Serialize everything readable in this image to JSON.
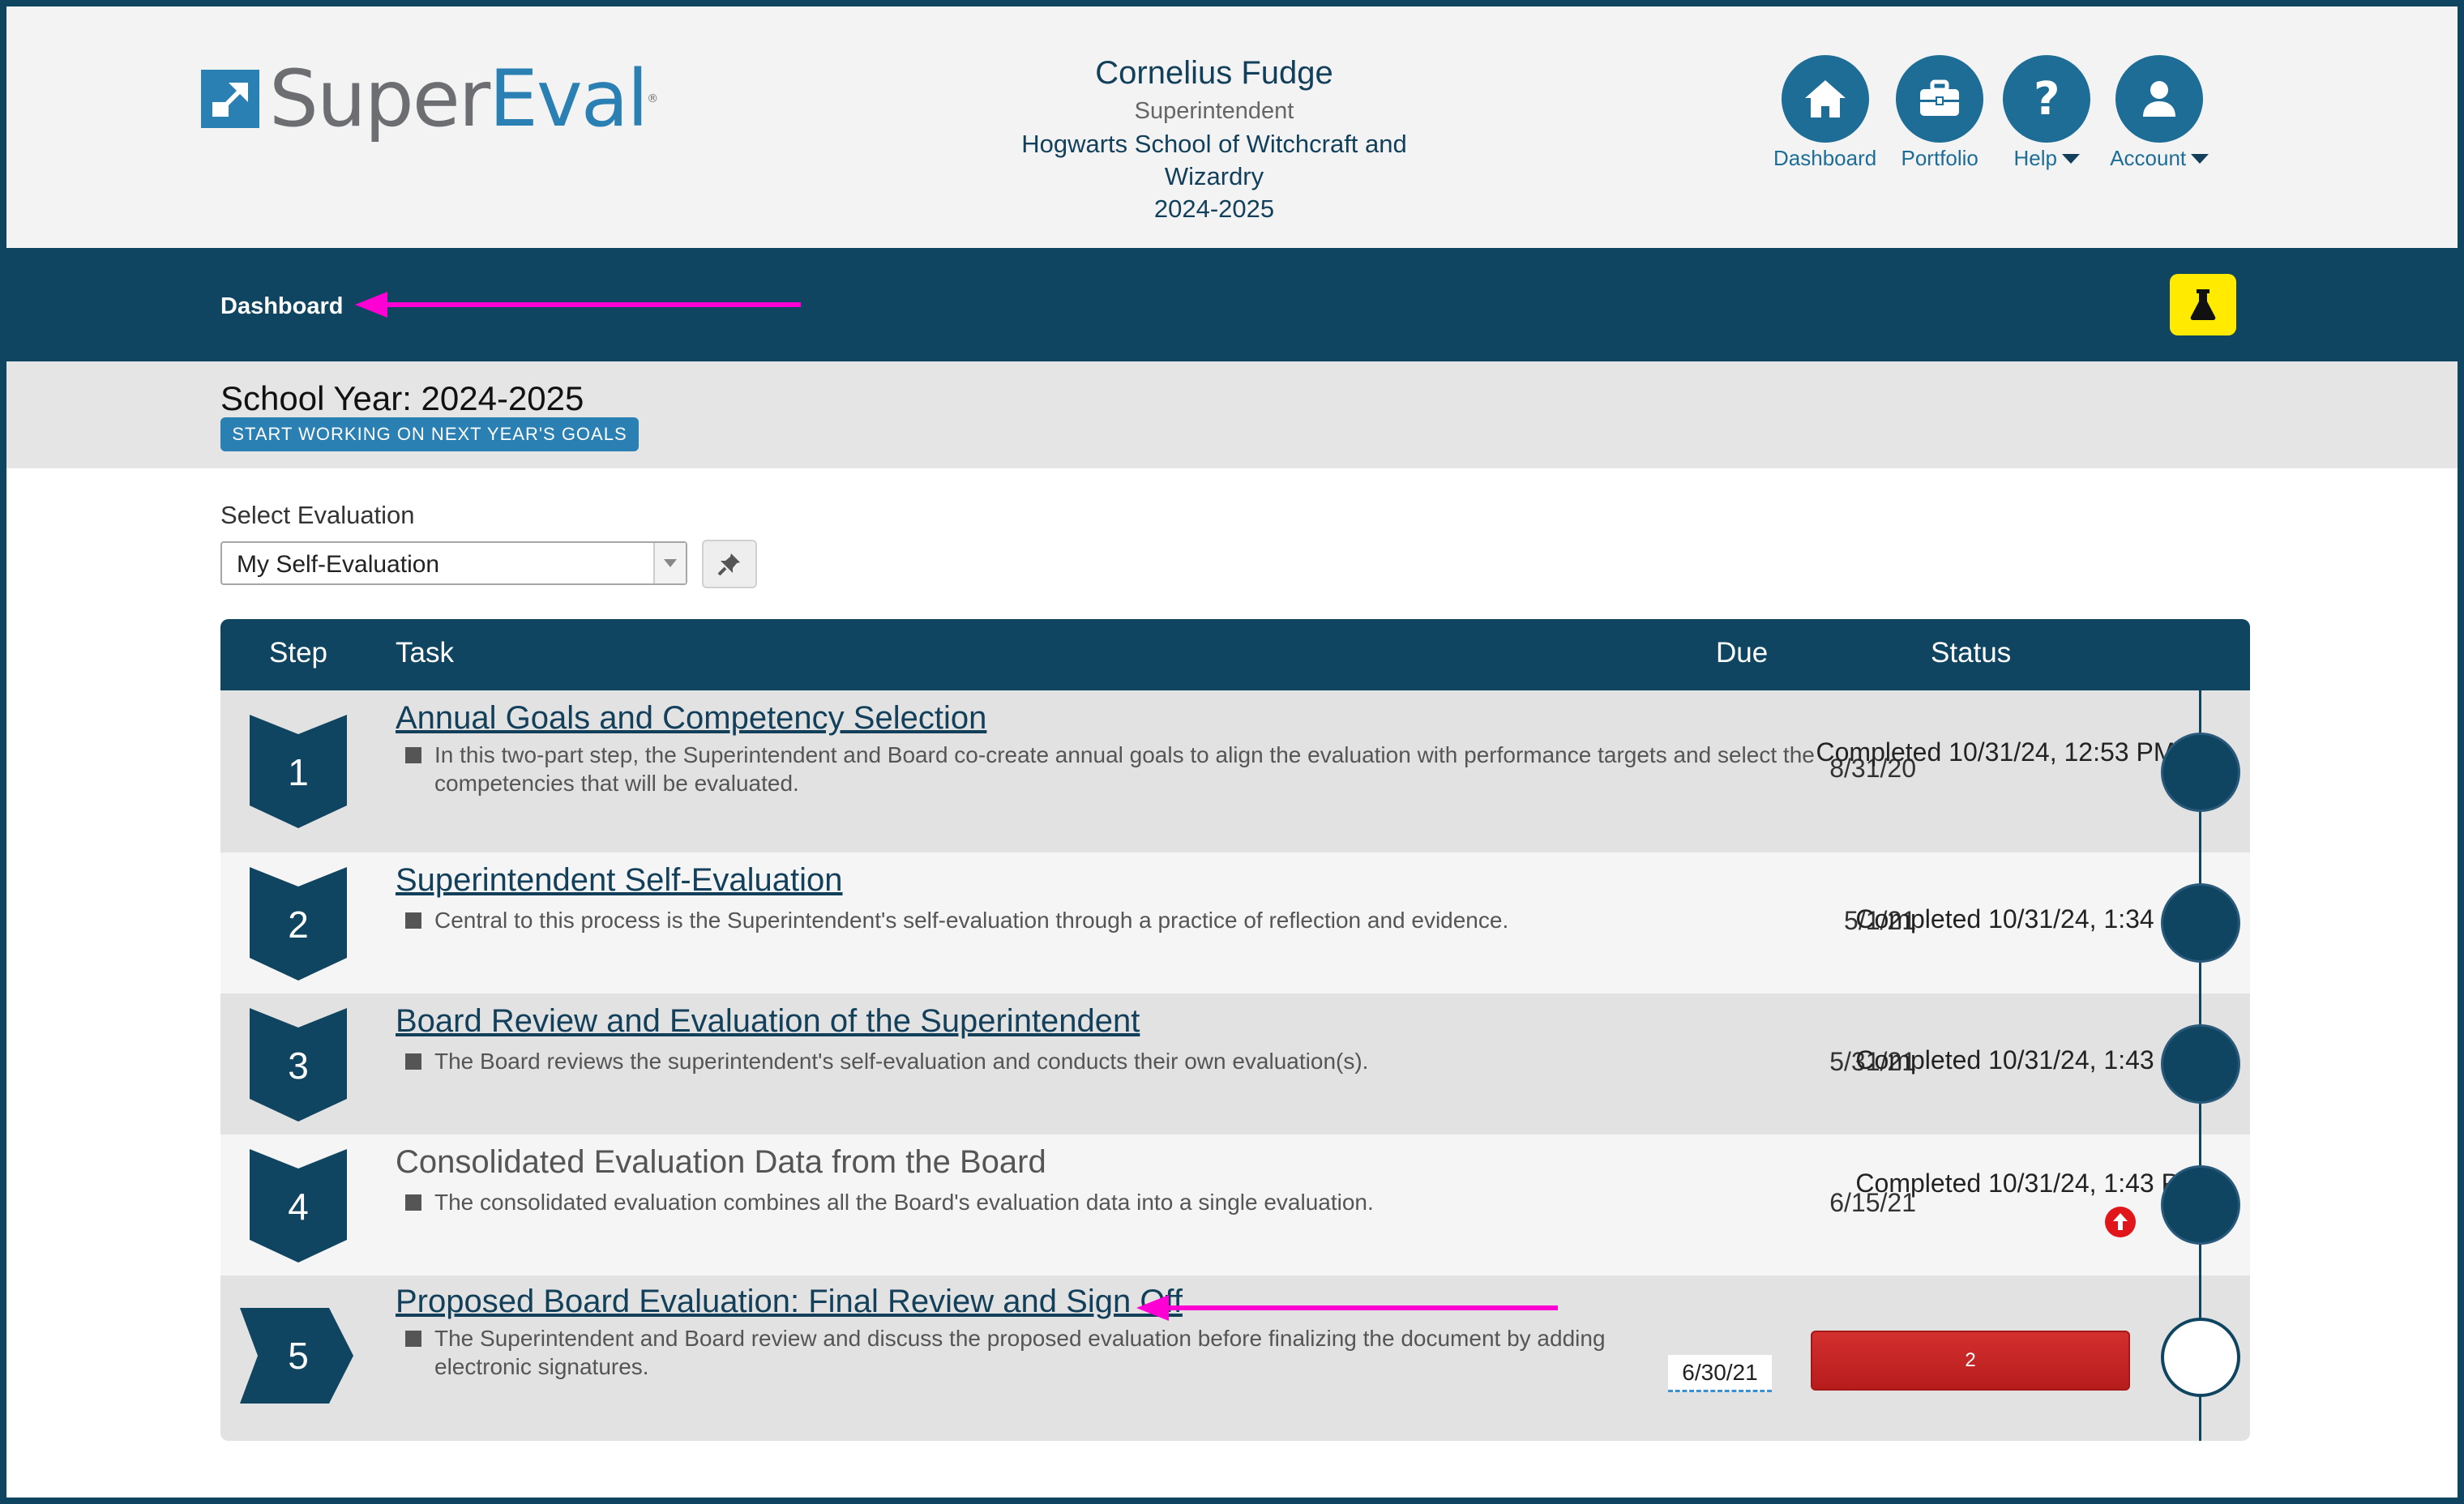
{
  "brand": {
    "super": "Super",
    "eval": "Eval",
    "reg": "®"
  },
  "user": {
    "name": "Cornelius Fudge",
    "role": "Superintendent",
    "school": "Hogwarts School of Witchcraft and Wizardry",
    "year": "2024-2025"
  },
  "nav": {
    "dashboard": "Dashboard",
    "portfolio": "Portfolio",
    "help": "Help",
    "account": "Account"
  },
  "breadcrumb": {
    "dashboard": "Dashboard"
  },
  "colors": {
    "navy": "#0f4560",
    "accent": "#2a7fb3",
    "flask": "#ffea00",
    "annotation_arrow": "#ff00d4",
    "alert_red": "#c62828"
  },
  "school_year": {
    "label": "School Year: 2024-2025",
    "button": "START WORKING ON NEXT YEAR'S GOALS"
  },
  "select": {
    "label": "Select Evaluation",
    "value": "My Self-Evaluation"
  },
  "table": {
    "headers": {
      "step": "Step",
      "task": "Task",
      "due": "Due",
      "status": "Status"
    },
    "rows": [
      {
        "step": "1",
        "title": "Annual Goals and Competency Selection",
        "desc": "In this two-part step, the Superintendent and Board co-create annual goals to align the evaluation with performance targets and select the competencies that will be evaluated.",
        "due": "8/31/20",
        "status": "Completed 10/31/24, 12:53 PM"
      },
      {
        "step": "2",
        "title": "Superintendent Self-Evaluation",
        "desc": "Central to this process is the Superintendent's self-evaluation through a practice of reflection and evidence.",
        "due": "5/1/21",
        "status": "Completed 10/31/24, 1:34 PM"
      },
      {
        "step": "3",
        "title": "Board Review and Evaluation of the Superintendent",
        "desc": "The Board reviews the superintendent's self-evaluation and conducts their own evaluation(s).",
        "due": "5/31/21",
        "status": "Completed 10/31/24, 1:43 PM"
      },
      {
        "step": "4",
        "title": "Consolidated Evaluation Data from the Board",
        "desc": "The consolidated evaluation combines all the Board's evaluation data into a single evaluation.",
        "due": "6/15/21",
        "status": "Completed 10/31/24, 1:43 PM"
      },
      {
        "step": "5",
        "title": "Proposed Board Evaluation: Final Review and Sign Off",
        "desc": "The Superintendent and Board review and discuss the proposed evaluation before finalizing the document by adding electronic signatures.",
        "due": "6/30/21",
        "status_button": "2"
      }
    ]
  }
}
